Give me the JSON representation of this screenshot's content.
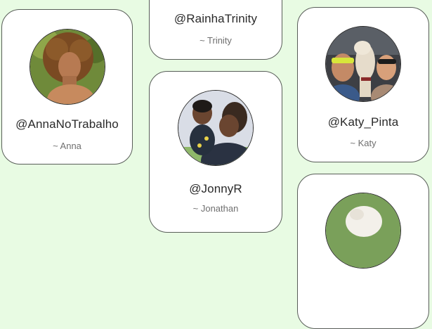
{
  "profiles": [
    {
      "handle": "@AnnaNoTrabalho",
      "name": "~ Anna"
    },
    {
      "handle": "@RainhaTrinity",
      "name": "~ Trinity"
    },
    {
      "handle": "@Katy_Pinta",
      "name": "~ Katy"
    },
    {
      "handle": "@JonnyR",
      "name": "~ Jonathan"
    },
    {
      "handle": "",
      "name": ""
    }
  ],
  "colors": {
    "background": "#e8fbe3",
    "card": "#ffffff",
    "card_border": "#585d58",
    "handle_text": "#2a2a2a",
    "name_text": "#6f6f6f"
  }
}
